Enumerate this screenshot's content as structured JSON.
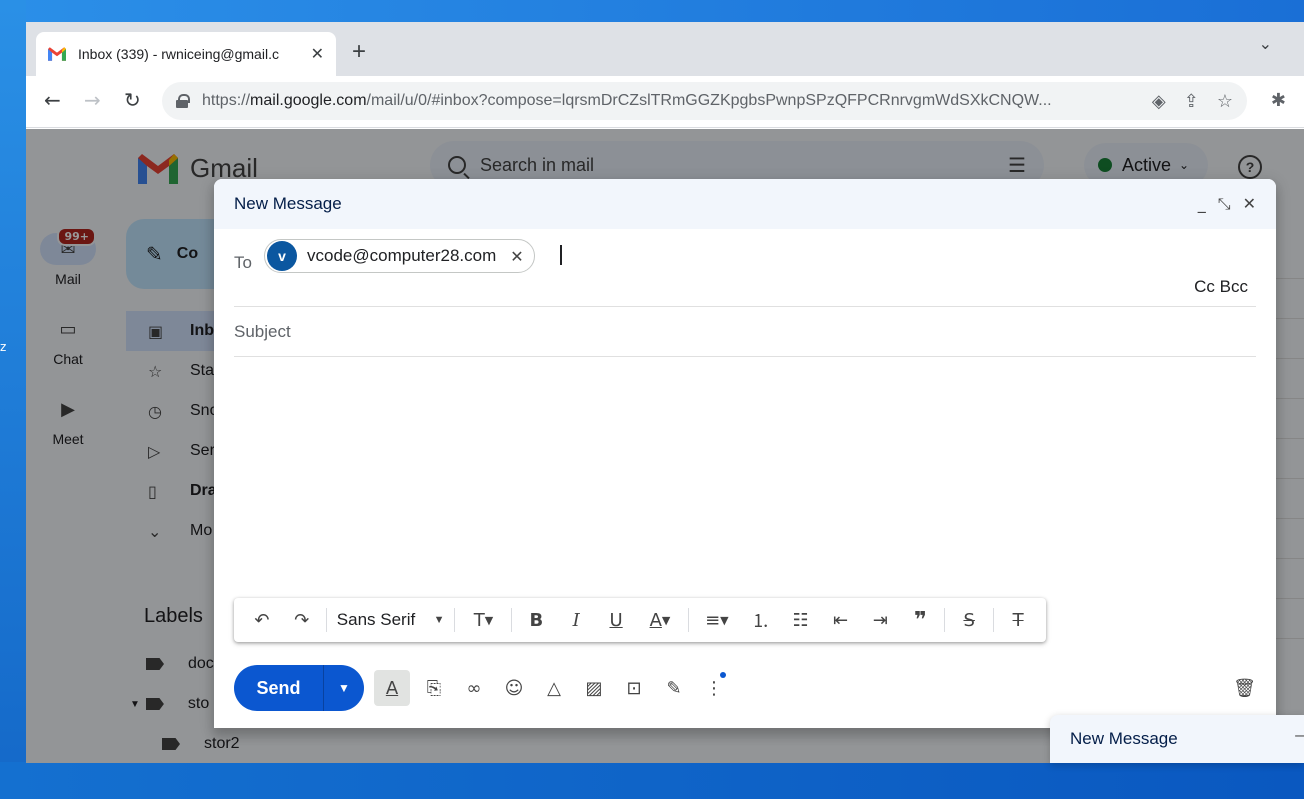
{
  "browser": {
    "tab_title": "Inbox (339) - rwniceing@gmail.c",
    "new_tab_symbol": "+",
    "url_scheme": "https://",
    "url_host": "mail.google.com",
    "url_path": "/mail/u/0/#inbox?compose=lqrsmDrCZslTRmGGZKpgbsPwnpSPzQFPCRnrvgmWdSXkCNQW..."
  },
  "gmail": {
    "logo_text": "Gmail",
    "search_placeholder": "Search in mail",
    "status": "Active",
    "rail": {
      "mail_label": "Mail",
      "mail_badge": "99+",
      "chat_label": "Chat",
      "meet_label": "Meet"
    },
    "compose_label": "Co",
    "nav": [
      "Inb",
      "Sta",
      "Sno",
      "Ser",
      "Dra",
      "Mo"
    ],
    "labels_heading": "Labels",
    "labels": [
      "doc",
      "sto",
      "stor2"
    ]
  },
  "compose": {
    "title": "New Message",
    "to_label": "To",
    "recipient_initial": "v",
    "recipient_email": "vcode@computer28.com",
    "cc_bcc": "Cc Bcc",
    "subject_placeholder": "Subject",
    "font_name": "Sans Serif",
    "send_label": "Send"
  },
  "mini_compose": {
    "title": "New Message"
  }
}
